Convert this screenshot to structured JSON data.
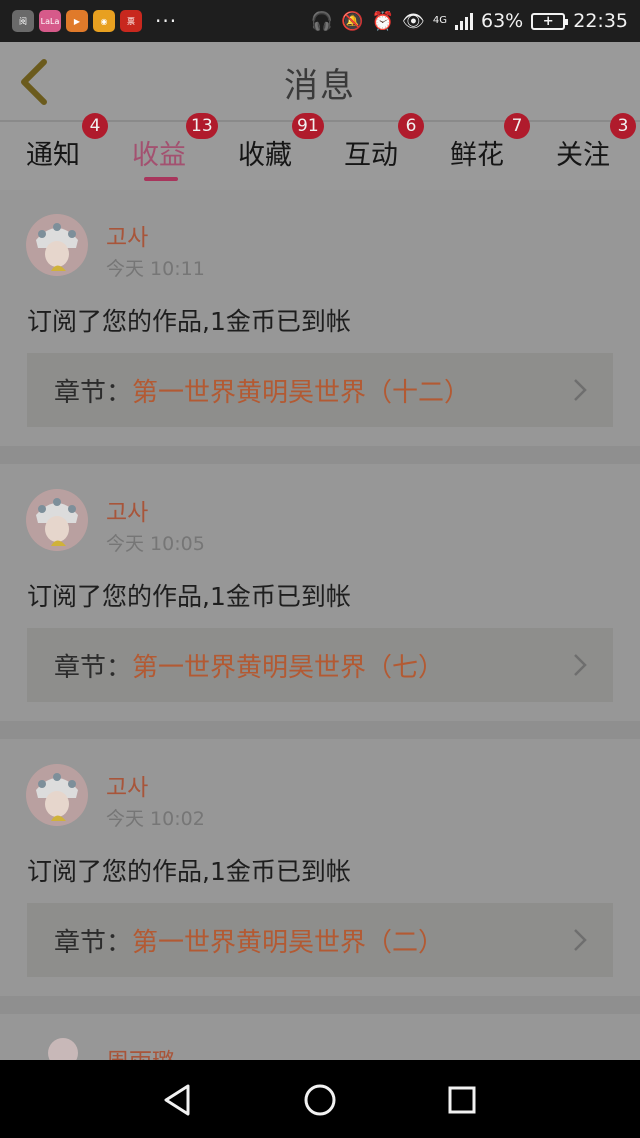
{
  "status_bar": {
    "apps": [
      {
        "name": "app-icon-1",
        "label": "阅",
        "color": "#6a6a6a"
      },
      {
        "name": "app-icon-2",
        "label": "LaLa",
        "color": "#d65a8a"
      },
      {
        "name": "app-icon-3",
        "label": "▶",
        "color": "#e07a2a"
      },
      {
        "name": "app-icon-4",
        "label": "◉",
        "color": "#e8a020"
      },
      {
        "name": "app-icon-5",
        "label": "票",
        "color": "#c8281e"
      }
    ],
    "more": "···",
    "network": "4G",
    "battery": "63%",
    "time": "22:35"
  },
  "header": {
    "title": "消息"
  },
  "tabs": [
    {
      "label": "通知",
      "badge": "4"
    },
    {
      "label": "收益",
      "badge": "13"
    },
    {
      "label": "收藏",
      "badge": "91"
    },
    {
      "label": "互动",
      "badge": "6"
    },
    {
      "label": "鲜花",
      "badge": "7"
    },
    {
      "label": "关注",
      "badge": "3"
    }
  ],
  "active_tab": "收益",
  "messages": [
    {
      "user": "고사",
      "time": "今天 10:11",
      "text": "订阅了您的作品,1金币已到帐",
      "chapter_label": "章节：",
      "chapter_title": "第一世界黄明昊世界（十二）"
    },
    {
      "user": "고사",
      "time": "今天 10:05",
      "text": "订阅了您的作品,1金币已到帐",
      "chapter_label": "章节：",
      "chapter_title": "第一世界黄明昊世界（七）"
    },
    {
      "user": "고사",
      "time": "今天 10:02",
      "text": "订阅了您的作品,1金币已到帐",
      "chapter_label": "章节：",
      "chapter_title": "第一世界黄明昊世界（二）"
    },
    {
      "user": "周雨璐"
    }
  ],
  "colors": {
    "accent": "#a8355c",
    "badge": "#b01b2c",
    "username": "#a8553a",
    "chapter": "#b35a33"
  }
}
